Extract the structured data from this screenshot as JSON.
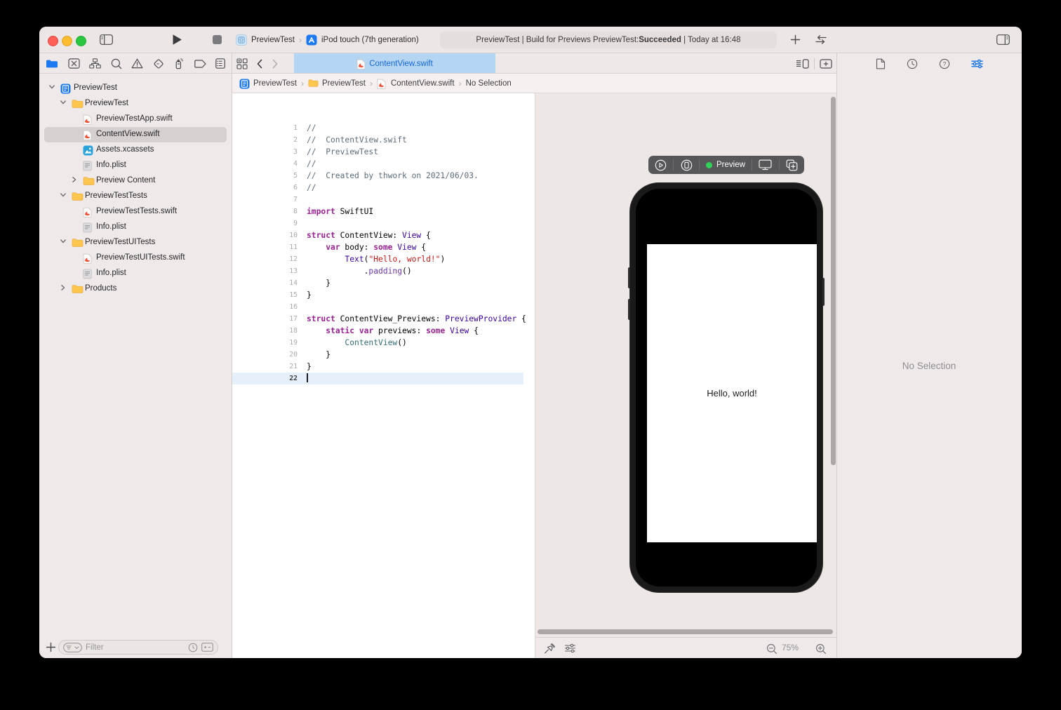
{
  "toolbar": {
    "scheme_project": "PreviewTest",
    "scheme_device": "iPod touch (7th generation)",
    "status_part1": "PreviewTest | Build for Previews PreviewTest: ",
    "status_bold": "Succeeded",
    "status_part2": " | Today at 16:48"
  },
  "navigator": {
    "toolbar_icons": [
      "project-navigator",
      "source-control",
      "symbols",
      "find",
      "issues",
      "tests",
      "debug",
      "breakpoints",
      "reports"
    ],
    "rows": [
      {
        "label": "PreviewTest",
        "icon": "project",
        "indent": 0,
        "disclosure": "open"
      },
      {
        "label": "PreviewTest",
        "icon": "folder",
        "indent": 1,
        "disclosure": "open"
      },
      {
        "label": "PreviewTestApp.swift",
        "icon": "swift",
        "indent": 2
      },
      {
        "label": "ContentView.swift",
        "icon": "swift",
        "indent": 2,
        "selected": true
      },
      {
        "label": "Assets.xcassets",
        "icon": "assets",
        "indent": 2
      },
      {
        "label": "Info.plist",
        "icon": "plist",
        "indent": 2
      },
      {
        "label": "Preview Content",
        "icon": "folder",
        "indent": 2,
        "disclosure": "closed"
      },
      {
        "label": "PreviewTestTests",
        "icon": "folder",
        "indent": 1,
        "disclosure": "open"
      },
      {
        "label": "PreviewTestTests.swift",
        "icon": "swift",
        "indent": 2
      },
      {
        "label": "Info.plist",
        "icon": "plist",
        "indent": 2
      },
      {
        "label": "PreviewTestUITests",
        "icon": "folder",
        "indent": 1,
        "disclosure": "open"
      },
      {
        "label": "PreviewTestUITests.swift",
        "icon": "swift",
        "indent": 2
      },
      {
        "label": "Info.plist",
        "icon": "plist",
        "indent": 2
      },
      {
        "label": "Products",
        "icon": "folder",
        "indent": 1,
        "disclosure": "closed"
      }
    ],
    "filter_placeholder": "Filter"
  },
  "tabbar": {
    "active_tab": "ContentView.swift"
  },
  "breadcrumb": [
    {
      "icon": "project",
      "label": "PreviewTest"
    },
    {
      "icon": "folder-sm",
      "label": "PreviewTest"
    },
    {
      "icon": "swift",
      "label": "ContentView.swift"
    },
    {
      "icon": null,
      "label": "No Selection"
    }
  ],
  "editor": {
    "lines": [
      {
        "n": 1,
        "segs": [
          [
            "//",
            "c"
          ]
        ]
      },
      {
        "n": 2,
        "segs": [
          [
            "//  ContentView.swift",
            "c"
          ]
        ]
      },
      {
        "n": 3,
        "segs": [
          [
            "//  PreviewTest",
            "c"
          ]
        ]
      },
      {
        "n": 4,
        "segs": [
          [
            "//",
            "c"
          ]
        ]
      },
      {
        "n": 5,
        "segs": [
          [
            "//  Created by thwork on 2021/06/03.",
            "c"
          ]
        ]
      },
      {
        "n": 6,
        "segs": [
          [
            "//",
            "c"
          ]
        ]
      },
      {
        "n": 7,
        "segs": []
      },
      {
        "n": 8,
        "segs": [
          [
            "import",
            "k"
          ],
          [
            " SwiftUI",
            "p"
          ]
        ]
      },
      {
        "n": 9,
        "segs": []
      },
      {
        "n": 10,
        "segs": [
          [
            "struct",
            "k"
          ],
          [
            " ContentView: ",
            "p"
          ],
          [
            "View",
            "t"
          ],
          [
            " {",
            "p"
          ]
        ]
      },
      {
        "n": 11,
        "segs": [
          [
            "    ",
            "p"
          ],
          [
            "var",
            "k"
          ],
          [
            " body: ",
            "p"
          ],
          [
            "some",
            "k"
          ],
          [
            " ",
            "p"
          ],
          [
            "View",
            "t"
          ],
          [
            " {",
            "p"
          ]
        ]
      },
      {
        "n": 12,
        "segs": [
          [
            "        ",
            "p"
          ],
          [
            "Text",
            "t"
          ],
          [
            "(",
            "p"
          ],
          [
            "\"Hello, world!\"",
            "s"
          ],
          [
            ")",
            "p"
          ]
        ]
      },
      {
        "n": 13,
        "segs": [
          [
            "            .",
            "p"
          ],
          [
            "padding",
            "f"
          ],
          [
            "()",
            "p"
          ]
        ]
      },
      {
        "n": 14,
        "segs": [
          [
            "    }",
            "p"
          ]
        ]
      },
      {
        "n": 15,
        "segs": [
          [
            "}",
            "p"
          ]
        ]
      },
      {
        "n": 16,
        "segs": []
      },
      {
        "n": 17,
        "segs": [
          [
            "struct",
            "k"
          ],
          [
            " ContentView_Previews: ",
            "p"
          ],
          [
            "PreviewProvider",
            "t"
          ],
          [
            " {",
            "p"
          ]
        ]
      },
      {
        "n": 18,
        "segs": [
          [
            "    ",
            "p"
          ],
          [
            "static",
            "k"
          ],
          [
            " ",
            "p"
          ],
          [
            "var",
            "k"
          ],
          [
            " previews: ",
            "p"
          ],
          [
            "some",
            "k"
          ],
          [
            " ",
            "p"
          ],
          [
            "View",
            "t"
          ],
          [
            " {",
            "p"
          ]
        ]
      },
      {
        "n": 19,
        "segs": [
          [
            "        ",
            "p"
          ],
          [
            "ContentView",
            "u"
          ],
          [
            "()",
            "p"
          ]
        ]
      },
      {
        "n": 20,
        "segs": [
          [
            "    }",
            "p"
          ]
        ]
      },
      {
        "n": 21,
        "segs": [
          [
            "}",
            "p"
          ]
        ]
      },
      {
        "n": 22,
        "segs": [],
        "hl": true,
        "cursor": true
      }
    ]
  },
  "canvas": {
    "preview_status_label": "Preview",
    "device_text": "Hello, world!",
    "zoom_level": "75%"
  },
  "inspector": {
    "empty_text": "No Selection"
  },
  "colors": {
    "accent_blue": "#1673E6",
    "tab_selected_bg": "#B5D6F3",
    "status_green": "#30D158",
    "traffic_red": "#FE5F57",
    "traffic_yellow": "#FEBC2F",
    "traffic_green": "#29C73F"
  }
}
